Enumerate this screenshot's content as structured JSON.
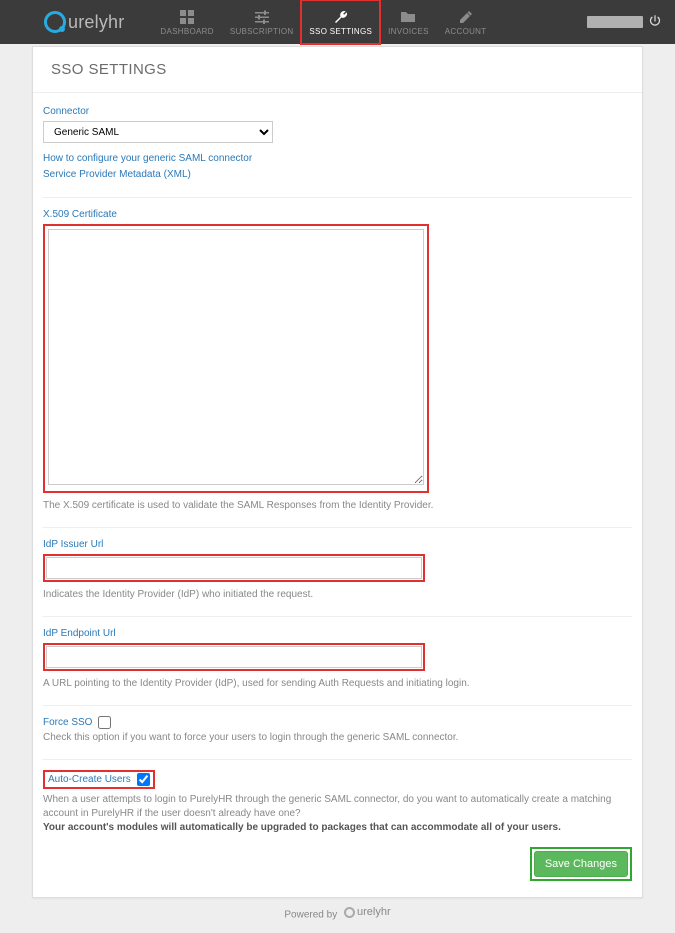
{
  "brand": {
    "name": "urelyhr"
  },
  "nav": {
    "dashboard": "DASHBOARD",
    "subscription": "SUBSCRIPTION",
    "sso_settings": "SSO SETTINGS",
    "invoices": "INVOICES",
    "account": "ACCOUNT"
  },
  "page": {
    "title": "SSO SETTINGS"
  },
  "connector": {
    "label": "Connector",
    "selected": "Generic SAML",
    "link_configure": "How to configure your generic SAML connector",
    "link_metadata": "Service Provider Metadata (XML)"
  },
  "cert": {
    "label": "X.509 Certificate",
    "value": "",
    "hint": "The X.509 certificate is used to validate the SAML Responses from the Identity Provider."
  },
  "issuer": {
    "label": "IdP Issuer Url",
    "value": "",
    "hint": "Indicates the Identity Provider (IdP) who initiated the request."
  },
  "endpoint": {
    "label": "IdP Endpoint Url",
    "value": "",
    "hint": "A URL pointing to the Identity Provider (IdP), used for sending Auth Requests and initiating login."
  },
  "force_sso": {
    "label": "Force SSO",
    "checked": false,
    "hint": "Check this option if you want to force your users to login through the generic SAML connector."
  },
  "auto_create": {
    "label": "Auto-Create Users",
    "checked": true,
    "hint1": "When a user attempts to login to PurelyHR through the generic SAML connector, do you want to automatically create a matching account in PurelyHR if the user doesn't already have one?",
    "hint2": "Your account's modules will automatically be upgraded to packages that can accommodate all of your users."
  },
  "actions": {
    "save": "Save Changes"
  },
  "footer": {
    "powered": "Powered by",
    "brand": "urelyhr"
  }
}
